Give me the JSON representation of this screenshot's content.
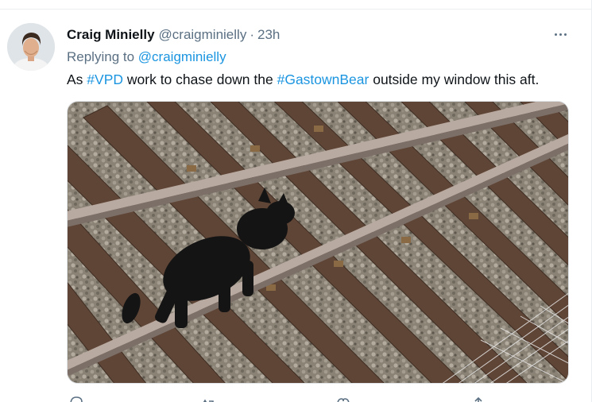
{
  "tweet": {
    "display_name": "Craig Minielly",
    "handle": "@craigminielly",
    "separator": "·",
    "time": "23h",
    "replying_prefix": "Replying to",
    "replying_to": "@craigminielly",
    "text_parts": {
      "t1": "As ",
      "hashtag1": "#VPD",
      "t2": " work to chase down the ",
      "hashtag2": "#GastownBear",
      "t3": " outside my window this aft."
    }
  },
  "icons": {
    "more": "more-horizontal-icon",
    "reply": "reply-icon",
    "retweet": "retweet-icon",
    "like": "heart-icon",
    "share": "share-icon"
  },
  "colors": {
    "link": "#1b95e0",
    "secondary_text": "#5b7083",
    "primary_text": "#0f1419"
  }
}
